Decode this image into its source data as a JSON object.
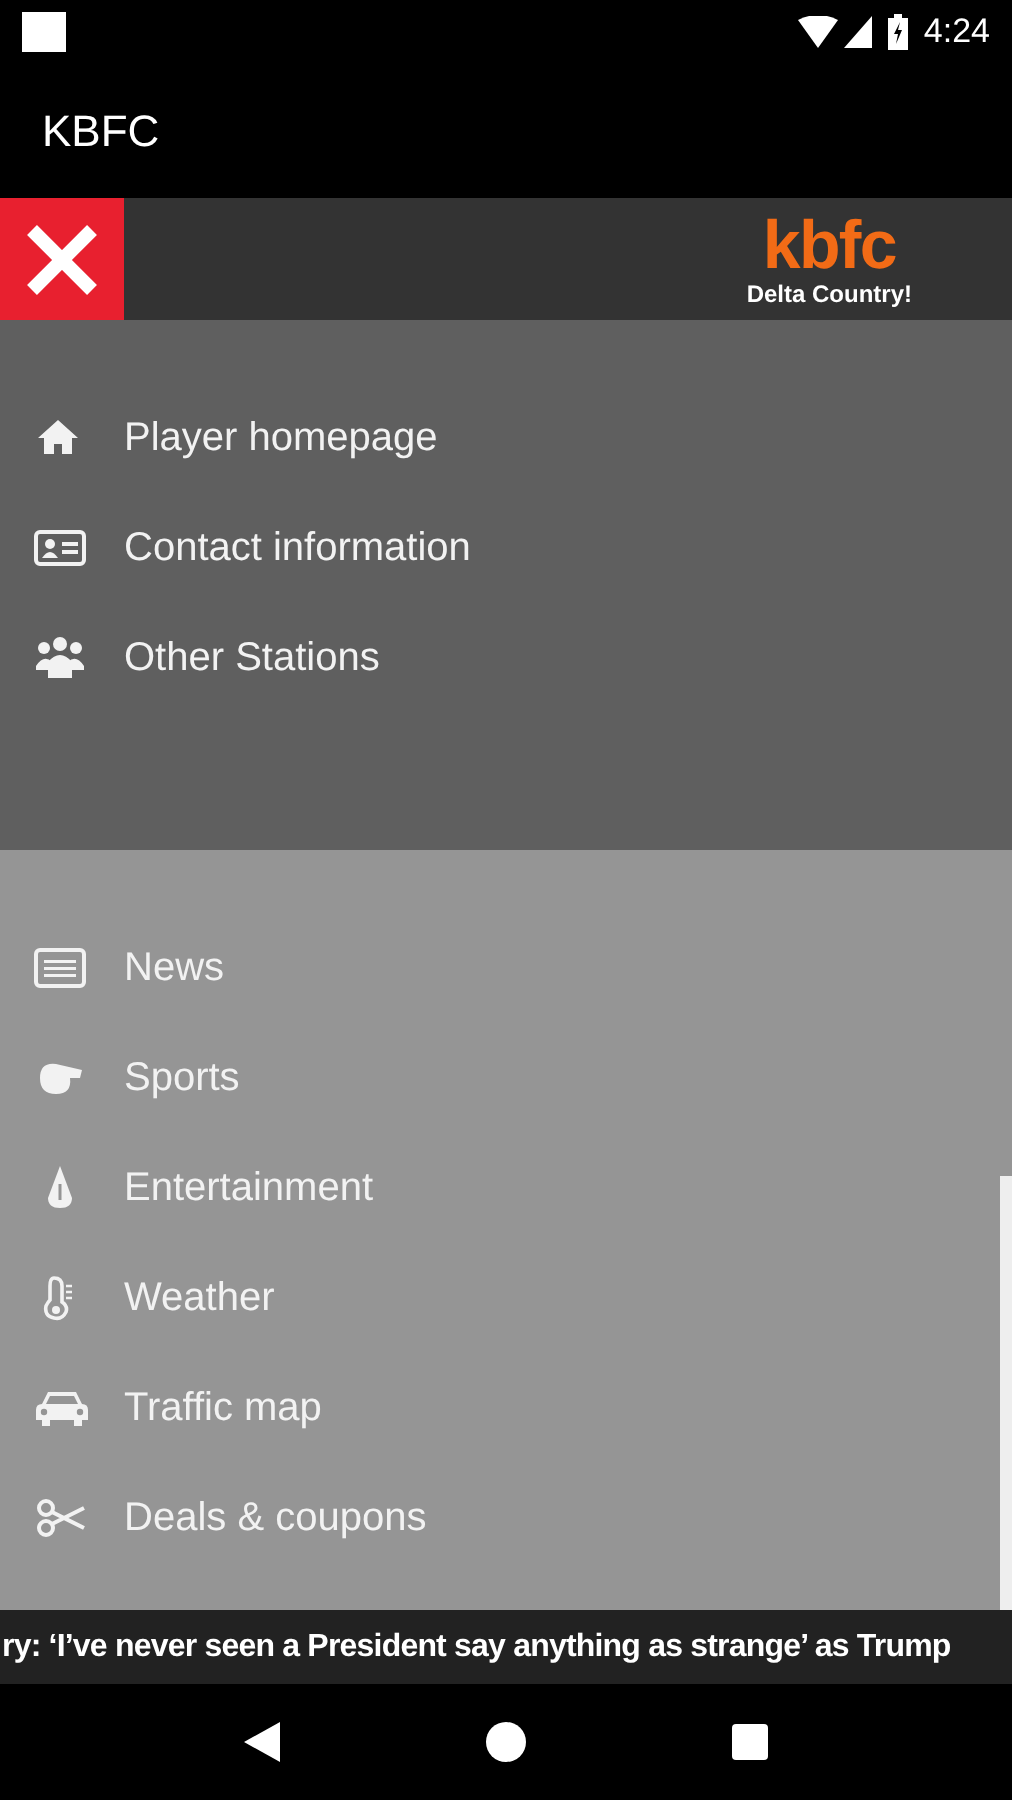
{
  "status_bar": {
    "time": "4:24"
  },
  "app_bar": {
    "title": "KBFC"
  },
  "drawer_header": {
    "logo_text": "kbfc",
    "logo_tagline": "Delta Country!"
  },
  "primary_items": [
    {
      "label": "Player homepage"
    },
    {
      "label": "Contact information"
    },
    {
      "label": "Other Stations"
    }
  ],
  "secondary_items": [
    {
      "label": "News"
    },
    {
      "label": "Sports"
    },
    {
      "label": "Entertainment"
    },
    {
      "label": "Weather"
    },
    {
      "label": "Traffic map"
    },
    {
      "label": "Deals & coupons"
    }
  ],
  "ticker": {
    "text": "ry: ‘I’ve never seen a President say anything as strange’ as Trump"
  }
}
